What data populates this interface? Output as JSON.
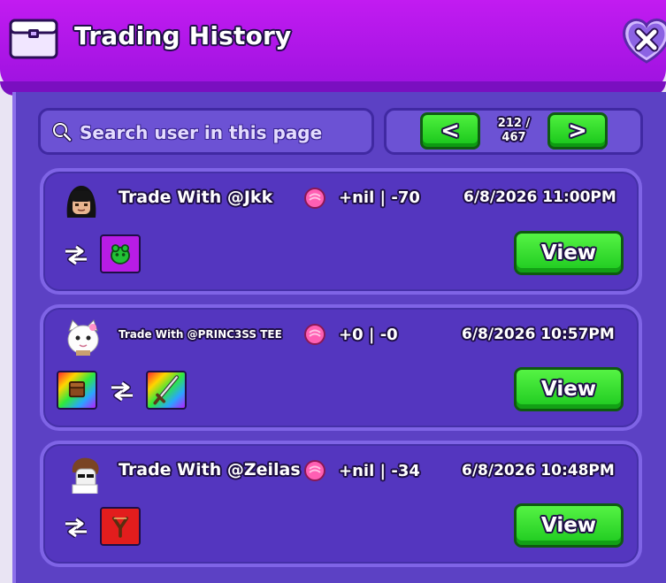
{
  "window": {
    "title": "Trading History",
    "close_icon": "close-icon"
  },
  "search": {
    "placeholder": "Search user in this page",
    "icon": "search-icon"
  },
  "pagination": {
    "prev_label": "<",
    "next_label": ">",
    "current_page": "212 /",
    "total_pages": "467"
  },
  "trades": [
    {
      "title": "Trade With @Jkk",
      "diff": "+nil | -70",
      "datetime": "6/8/2026 11:00PM",
      "view_label": "View",
      "left_items": [],
      "right_items": [
        "green-creature-item"
      ]
    },
    {
      "title": "Trade With @PRINC3SS TEE",
      "diff": "+0 | -0",
      "datetime": "6/8/2026 10:57PM",
      "view_label": "View",
      "left_items": [
        "rainbow-chest-item"
      ],
      "right_items": [
        "rainbow-sword-item"
      ]
    },
    {
      "title": "Trade With @Zeilas",
      "diff": "+nil | -34",
      "datetime": "6/8/2026 10:48PM",
      "view_label": "View",
      "left_items": [],
      "right_items": [
        "red-slingshot-item"
      ]
    }
  ],
  "colors": {
    "header": "#b417ec",
    "panel": "#5c41c4",
    "card": "#5436bf",
    "button_green": "#2fd92a",
    "text_outline": "#1e0f46"
  }
}
